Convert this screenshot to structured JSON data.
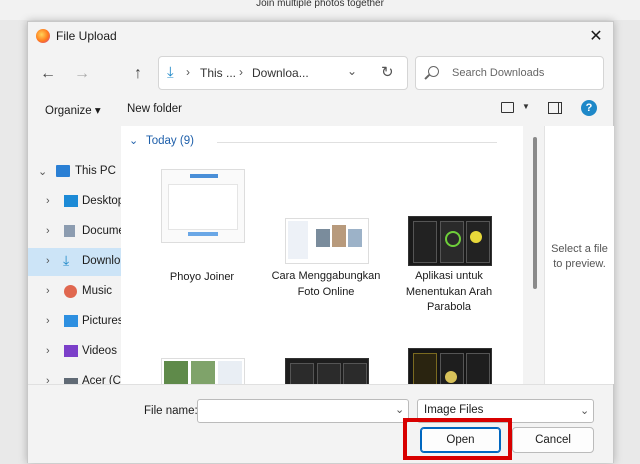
{
  "background": {
    "window_title": "Join multiple photos together"
  },
  "dialog": {
    "title": "File Upload",
    "close_glyph": "✕"
  },
  "nav": {
    "back_glyph": "←",
    "forward_glyph": "→",
    "up_glyph": "↑",
    "address": [
      "This ...",
      "Downloa..."
    ],
    "search_placeholder": "Search Downloads"
  },
  "commands": {
    "organize": "Organize ▾",
    "new_folder": "New folder",
    "help": "?"
  },
  "sidebar": [
    {
      "label": "This PC",
      "icon": "computer-icon"
    },
    {
      "label": "Desktop",
      "icon": "desktop-icon"
    },
    {
      "label": "Docume",
      "icon": "documents-icon"
    },
    {
      "label": "Downlo",
      "icon": "download-icon"
    },
    {
      "label": "Music",
      "icon": "music-icon"
    },
    {
      "label": "Pictures",
      "icon": "pictures-icon"
    },
    {
      "label": "Videos",
      "icon": "videos-icon"
    },
    {
      "label": "Acer (C:",
      "icon": "drive-icon"
    }
  ],
  "group": {
    "heading": "Today (9)"
  },
  "files": [
    {
      "name": "Phoyo Joiner"
    },
    {
      "name": "Cara Menggabungkan Foto Online"
    },
    {
      "name": "Aplikasi untuk Menentukan Arah Parabola"
    },
    {
      "name": ""
    },
    {
      "name": ""
    },
    {
      "name": ""
    }
  ],
  "preview": {
    "text": "Select a file to preview."
  },
  "bottom": {
    "file_name_label": "File name:",
    "file_name_value": "",
    "file_type": "Image Files",
    "open_label": "Open",
    "cancel_label": "Cancel"
  },
  "colors": {
    "accent": "#0067c0",
    "highlight": "#d80000",
    "selected": "#cce4f7"
  }
}
